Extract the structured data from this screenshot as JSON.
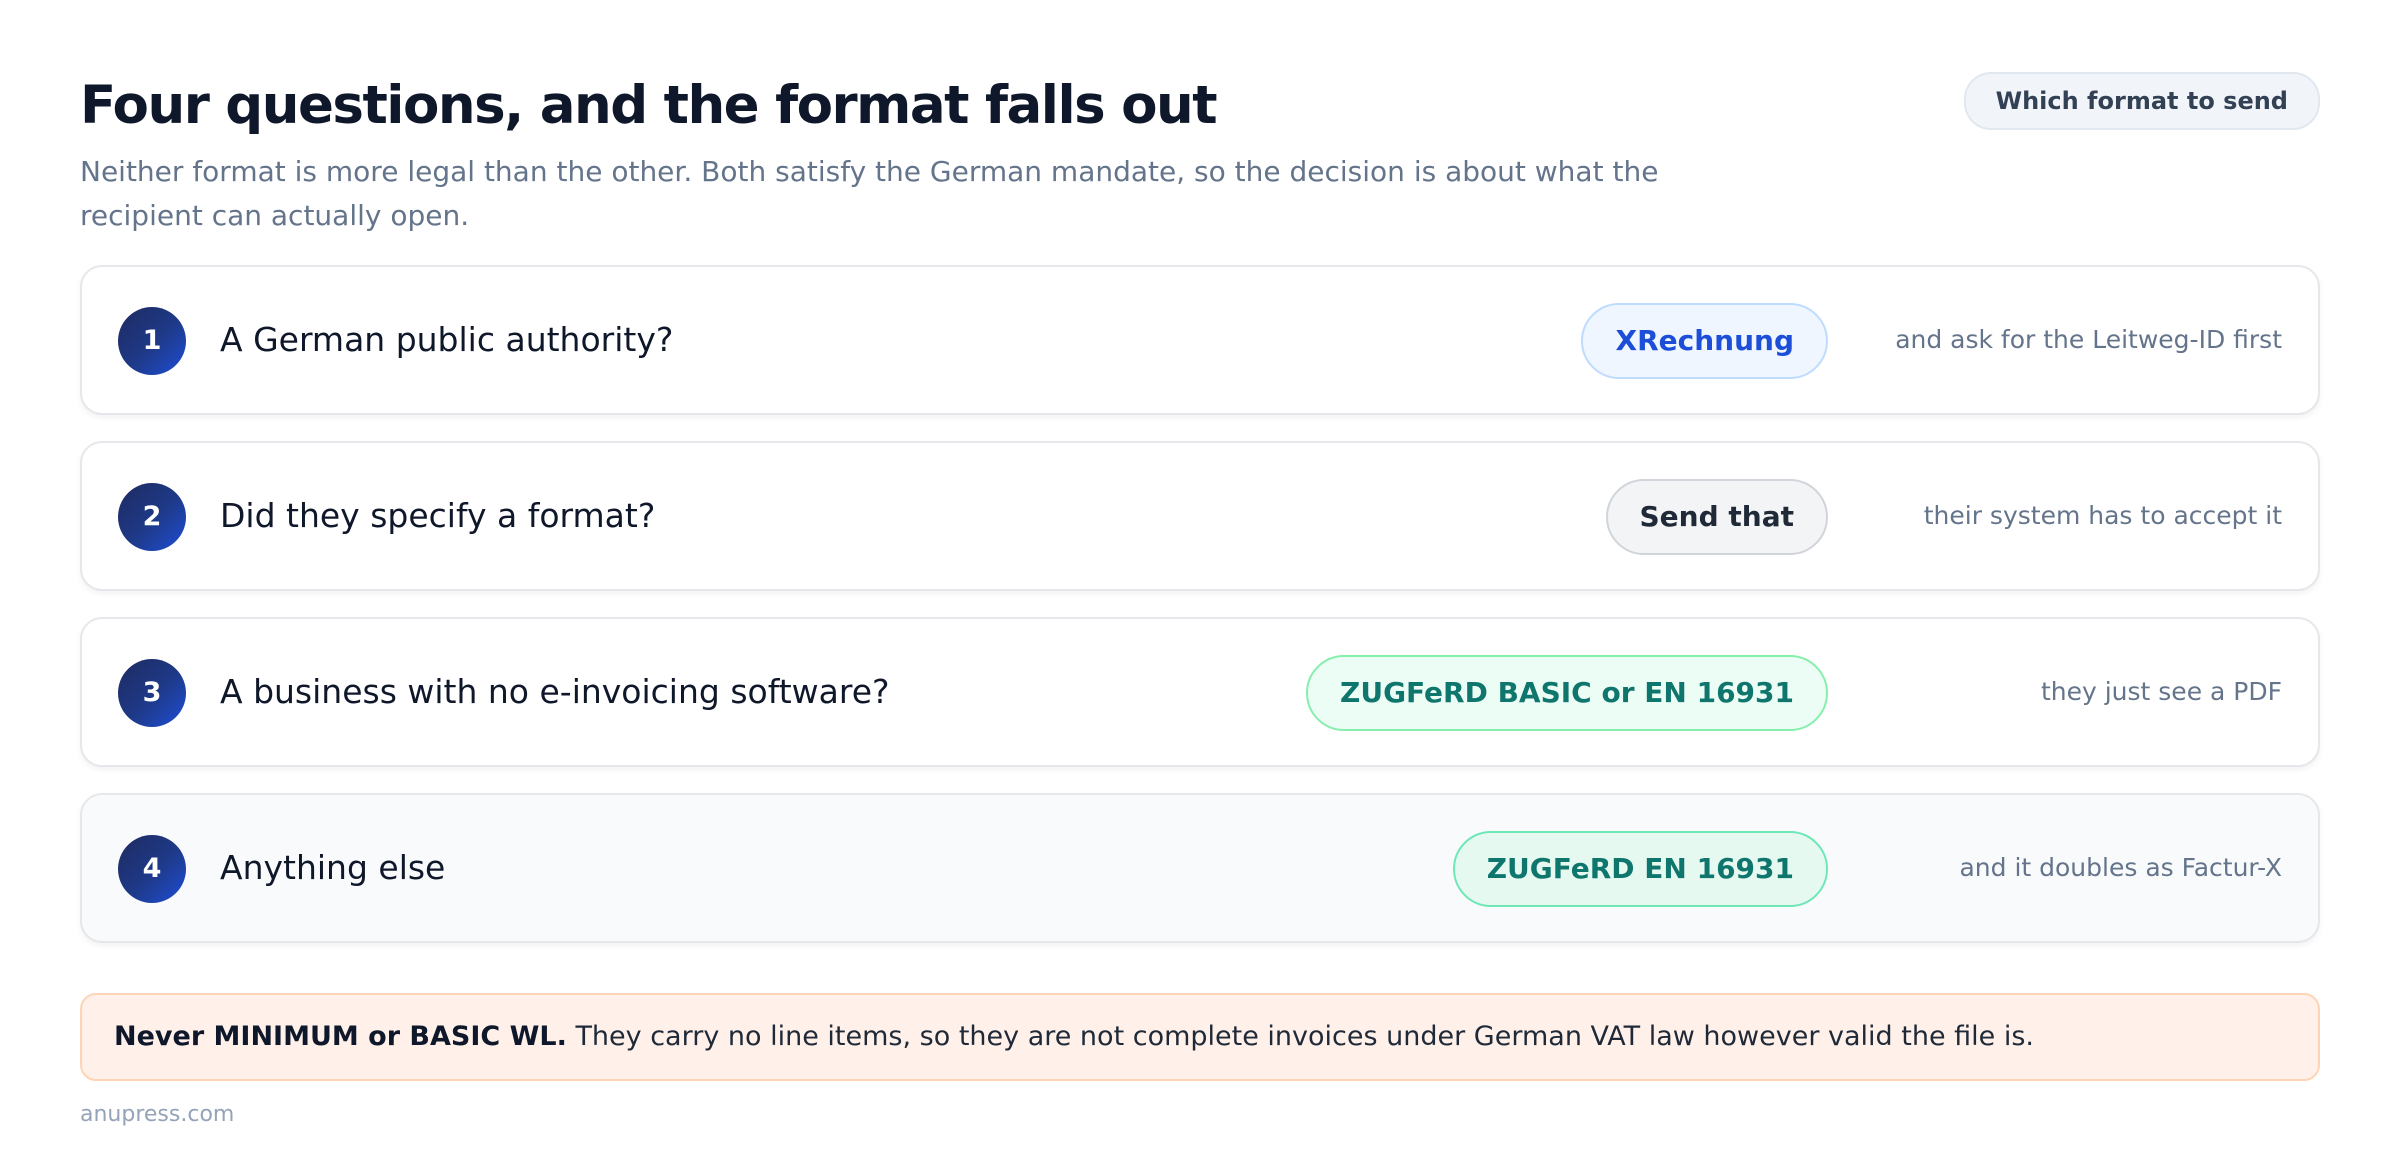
{
  "header": {
    "title": "Four questions, and the format falls out",
    "subtitle": "Neither format is more legal than the other. Both satisfy the German mandate, so the decision is about what the recipient can actually open.",
    "tag": "Which format to send"
  },
  "steps": [
    {
      "number": "1",
      "question": "A German public authority?",
      "answer": "XRechnung",
      "note": "and ask for the Leitweg-ID first",
      "answer_color": "#1d4ed8"
    },
    {
      "number": "2",
      "question": "Did they specify a format?",
      "answer": "Send that",
      "note": "their system has to accept it",
      "answer_color": "#1f2937"
    },
    {
      "number": "3",
      "question": "A business with no e-invoicing software?",
      "answer": "ZUGFeRD BASIC or EN 16931",
      "note": "they just see a PDF",
      "answer_color": "#0f766e"
    },
    {
      "number": "4",
      "question": "Anything else",
      "answer": "ZUGFeRD EN 16931",
      "note": "and it doubles as Factur-X",
      "answer_color": "#0f766e"
    }
  ],
  "warning": {
    "lead": "Never MINIMUM or BASIC WL.",
    "text": "They carry no line items, so they are not complete invoices under German VAT law however valid the file is."
  },
  "footer": {
    "source": "anupress.com"
  }
}
